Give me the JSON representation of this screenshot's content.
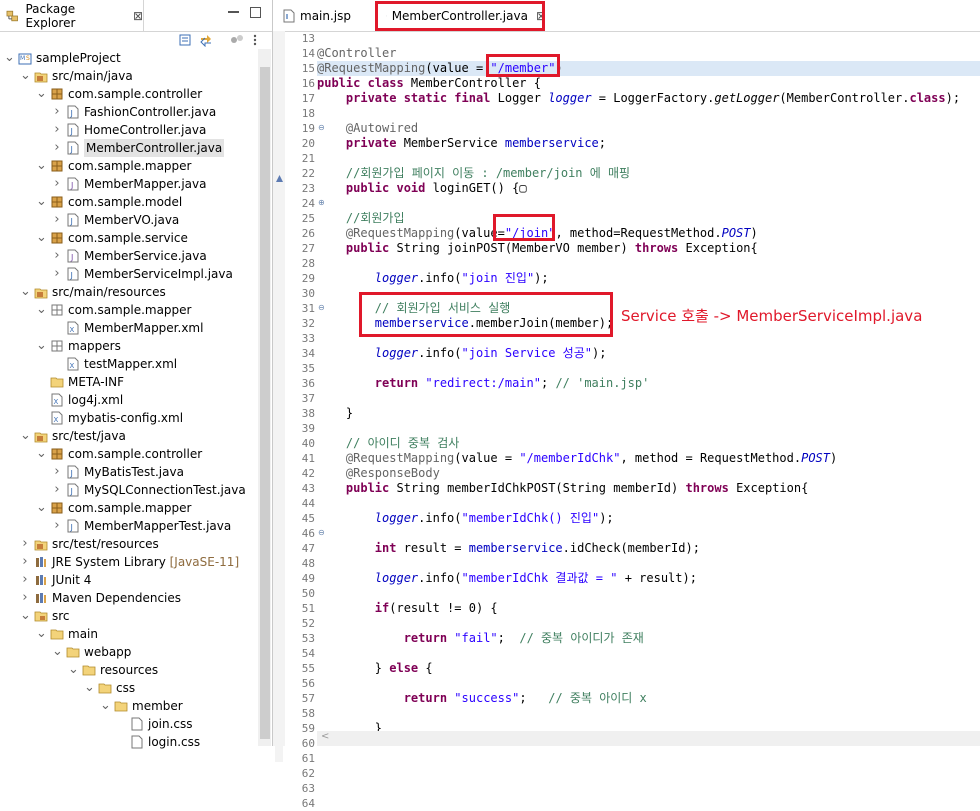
{
  "package_explorer": {
    "tab_label": "Package Explorer",
    "close_glyph": "⊠",
    "tree": [
      {
        "label": "sampleProject",
        "icon": "project-icon",
        "chev": "v"
      },
      {
        "label": "src/main/java",
        "icon": "source-folder-icon",
        "chev": "v"
      },
      {
        "label": "com.sample.controller",
        "icon": "package-icon",
        "chev": "v"
      },
      {
        "label": "FashionController.java",
        "icon": "java-file-icon",
        "chev": ">"
      },
      {
        "label": "HomeController.java",
        "icon": "java-file-icon",
        "chev": ">"
      },
      {
        "label": "MemberController.java",
        "icon": "java-file-icon",
        "chev": ">",
        "selected": true
      },
      {
        "label": "com.sample.mapper",
        "icon": "package-icon",
        "chev": "v"
      },
      {
        "label": "MemberMapper.java",
        "icon": "java-interface-icon",
        "chev": ">"
      },
      {
        "label": "com.sample.model",
        "icon": "package-icon",
        "chev": "v"
      },
      {
        "label": "MemberVO.java",
        "icon": "java-file-icon",
        "chev": ">"
      },
      {
        "label": "com.sample.service",
        "icon": "package-icon",
        "chev": "v"
      },
      {
        "label": "MemberService.java",
        "icon": "java-interface-icon",
        "chev": ">"
      },
      {
        "label": "MemberServiceImpl.java",
        "icon": "java-file-icon",
        "chev": ">"
      },
      {
        "label": "src/main/resources",
        "icon": "source-folder-icon",
        "chev": "v"
      },
      {
        "label": "com.sample.mapper",
        "icon": "package-outline-icon",
        "chev": "v"
      },
      {
        "label": "MemberMapper.xml",
        "icon": "xml-file-icon",
        "chev": ""
      },
      {
        "label": "mappers",
        "icon": "package-outline-icon",
        "chev": "v"
      },
      {
        "label": "testMapper.xml",
        "icon": "xml-file-icon",
        "chev": ""
      },
      {
        "label": "META-INF",
        "icon": "folder-icon",
        "chev": ""
      },
      {
        "label": "log4j.xml",
        "icon": "xml-file-icon",
        "chev": ""
      },
      {
        "label": "mybatis-config.xml",
        "icon": "xml-file-icon",
        "chev": ""
      },
      {
        "label": "src/test/java",
        "icon": "source-folder-icon",
        "chev": "v"
      },
      {
        "label": "com.sample.controller",
        "icon": "package-icon",
        "chev": "v"
      },
      {
        "label": "MyBatisTest.java",
        "icon": "java-file-icon",
        "chev": ">"
      },
      {
        "label": "MySQLConnectionTest.java",
        "icon": "java-file-icon",
        "chev": ">"
      },
      {
        "label": "com.sample.mapper",
        "icon": "package-icon",
        "chev": "v"
      },
      {
        "label": "MemberMapperTest.java",
        "icon": "java-file-icon",
        "chev": ">"
      },
      {
        "label": "src/test/resources",
        "icon": "source-folder-icon",
        "chev": ">"
      },
      {
        "label": "JRE System Library",
        "suffix": "[JavaSE-11]",
        "icon": "library-icon",
        "chev": ">"
      },
      {
        "label": "JUnit 4",
        "icon": "library-icon",
        "chev": ">"
      },
      {
        "label": "Maven Dependencies",
        "icon": "library-icon",
        "chev": ">"
      },
      {
        "label": "src",
        "icon": "folder-src-icon",
        "chev": "v"
      },
      {
        "label": "main",
        "icon": "folder-icon",
        "chev": "v"
      },
      {
        "label": "webapp",
        "icon": "folder-icon",
        "chev": "v"
      },
      {
        "label": "resources",
        "icon": "folder-icon",
        "chev": "v"
      },
      {
        "label": "css",
        "icon": "folder-icon",
        "chev": "v"
      },
      {
        "label": "member",
        "icon": "folder-icon",
        "chev": "v"
      },
      {
        "label": "join.css",
        "icon": "file-icon",
        "chev": ""
      },
      {
        "label": "login.css",
        "icon": "file-icon",
        "chev": ""
      }
    ]
  },
  "editor": {
    "tabs": [
      {
        "label": "main.jsp"
      },
      {
        "label": "MemberController.java",
        "active": true,
        "close": "⊠"
      }
    ],
    "line_numbers": [
      "13",
      "14",
      "15",
      "16",
      "17",
      "18",
      "19",
      "20",
      "21",
      "22",
      "23",
      "24",
      "25",
      "26",
      "27",
      "28",
      "29",
      "30",
      "31",
      "32",
      "33",
      "34",
      "35",
      "36",
      "37",
      "38",
      "39",
      "40",
      "41",
      "42",
      "43",
      "44",
      "45",
      "46",
      "47",
      "48",
      "49",
      "50",
      "51",
      "52",
      "53",
      "54",
      "55",
      "56",
      "57",
      "58",
      "59",
      "60",
      "61",
      "62",
      "63",
      "64"
    ],
    "code": {
      "l14": "@Controller",
      "l15a": "@RequestMapping",
      "l15b": "(value = ",
      "l15c": "\"/member\"",
      "l15d": ")",
      "l16a": "public class",
      "l16b": " MemberController {",
      "l17a": "    ",
      "l17b": "private static final",
      "l17c": " Logger ",
      "l17d": "logger",
      "l17e": " = LoggerFactory.",
      "l17f": "getLogger",
      "l17g": "(MemberController.",
      "l17h": "class",
      "l17i": ");",
      "l19": "    @Autowired",
      "l20a": "    ",
      "l20b": "private",
      "l20c": " MemberService ",
      "l20d": "memberservice",
      "l20e": ";",
      "l22": "    //회원가입 페이지 이동 : /member/join 에 매핑",
      "l23a": "    ",
      "l23b": "public void",
      "l23c": " loginGET() {",
      "l23d": "▢",
      "l25": "    //회원가입",
      "l26a": "    @RequestMapping",
      "l26b": "(value=",
      "l26c": "\"/join\"",
      "l26d": ", method=RequestMethod.",
      "l26e": "POST",
      "l26f": ")",
      "l27a": "    ",
      "l27b": "public",
      "l27c": " String joinPOST(MemberVO member) ",
      "l27d": "throws",
      "l27e": " Exception{",
      "l29a": "        ",
      "l29b": "logger",
      "l29c": ".info(",
      "l29d": "\"join 진입\"",
      "l29e": ");",
      "l31": "        // 회원가입 서비스 실행",
      "l32a": "        ",
      "l32b": "memberservice",
      "l32c": ".memberJoin(member);",
      "l34a": "        ",
      "l34b": "logger",
      "l34c": ".info(",
      "l34d": "\"join Service 성공\"",
      "l34e": ");",
      "l36a": "        ",
      "l36b": "return",
      "l36c": " ",
      "l36d": "\"redirect:/main\"",
      "l36e": "; ",
      "l36f": "// 'main.jsp'",
      "l38": "    }",
      "l40": "    // 아이디 중복 검사",
      "l41a": "    @RequestMapping",
      "l41b": "(value = ",
      "l41c": "\"/memberIdChk\"",
      "l41d": ", method = RequestMethod.",
      "l41e": "POST",
      "l41f": ")",
      "l42": "    @ResponseBody",
      "l43a": "    ",
      "l43b": "public",
      "l43c": " String memberIdChkPOST(String memberId) ",
      "l43d": "throws",
      "l43e": " Exception{",
      "l45a": "        ",
      "l45b": "logger",
      "l45c": ".info(",
      "l45d": "\"memberIdChk() 진입\"",
      "l45e": ");",
      "l47a": "        ",
      "l47b": "int",
      "l47c": " result = ",
      "l47d": "memberservice",
      "l47e": ".idCheck(memberId);",
      "l49a": "        ",
      "l49b": "logger",
      "l49c": ".info(",
      "l49d": "\"memberIdChk 결과값 = \"",
      "l49e": " + result);",
      "l51a": "        ",
      "l51b": "if",
      "l51c": "(result != 0) {",
      "l53a": "            ",
      "l53b": "return",
      "l53c": " ",
      "l53d": "\"fail\"",
      "l53e": ";  ",
      "l53f": "// 중복 아이디가 존재",
      "l55a": "        } ",
      "l55b": "else",
      "l55c": " {",
      "l57a": "            ",
      "l57b": "return",
      "l57c": " ",
      "l57d": "\"success\"",
      "l57e": ";   ",
      "l57f": "// 중복 아이디 x",
      "l59": "        }"
    },
    "annotation": "Service 호출 -> MemberServiceImpl.java",
    "scroll_arrow": "<"
  },
  "colors": {
    "annotation_red": "#e0182a",
    "keyword": "#7f0055",
    "string": "#2a00ff",
    "comment": "#3f7f5f",
    "field": "#0000c0"
  }
}
